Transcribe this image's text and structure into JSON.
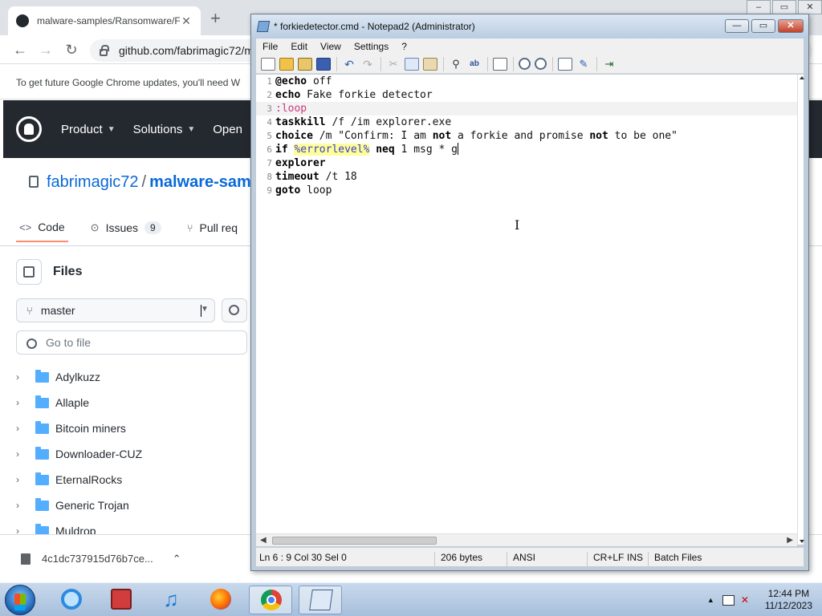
{
  "chrome": {
    "tab_title": "malware-samples/Ransomware/F",
    "new_tab": "+",
    "url": "github.com/fabrimagic72/m",
    "infobar": "To get future Google Chrome updates, you'll need W",
    "github_nav": [
      "Product",
      "Solutions",
      "Open"
    ],
    "repo_owner": "fabrimagic72",
    "repo_sep": "/",
    "repo_name": "malware-sam",
    "tabs": [
      {
        "label": "Code"
      },
      {
        "label": "Issues",
        "count": "9"
      },
      {
        "label": "Pull req"
      }
    ],
    "files_title": "Files",
    "branch": "master",
    "goto_placeholder": "Go to file",
    "tree": [
      "Adylkuzz",
      "Allaple",
      "Bitcoin miners",
      "Downloader-CUZ",
      "EternalRocks",
      "Generic Trojan",
      "Muldrop"
    ],
    "download_name": "4c1dc737915d76b7ce..."
  },
  "notepad": {
    "title": "* forkiedetector.cmd - Notepad2 (Administrator)",
    "menu": [
      "File",
      "Edit",
      "View",
      "Settings",
      "?"
    ],
    "lines": [
      {
        "n": "1",
        "parts": [
          {
            "t": "@echo",
            "c": "kw"
          },
          {
            "t": " off",
            "c": ""
          }
        ]
      },
      {
        "n": "2",
        "parts": [
          {
            "t": "echo",
            "c": "kw"
          },
          {
            "t": " Fake forkie detector",
            "c": ""
          }
        ]
      },
      {
        "n": "3",
        "parts": [
          {
            "t": ":loop",
            "c": "lbl"
          }
        ]
      },
      {
        "n": "4",
        "parts": [
          {
            "t": "taskkill",
            "c": "kw"
          },
          {
            "t": " /f /im explorer.exe",
            "c": ""
          }
        ]
      },
      {
        "n": "5",
        "parts": [
          {
            "t": "choice",
            "c": "kw"
          },
          {
            "t": " /m \"Confirm: I am ",
            "c": ""
          },
          {
            "t": "not",
            "c": "kw"
          },
          {
            "t": " a forkie and promise ",
            "c": ""
          },
          {
            "t": "not",
            "c": "kw"
          },
          {
            "t": " to be one\"",
            "c": ""
          }
        ]
      },
      {
        "n": "6",
        "parts": [
          {
            "t": "if",
            "c": "kw"
          },
          {
            "t": " ",
            "c": ""
          },
          {
            "t": "%errorlevel%",
            "c": "var"
          },
          {
            "t": " ",
            "c": ""
          },
          {
            "t": "neq",
            "c": "kw"
          },
          {
            "t": " 1 msg * g",
            "c": ""
          }
        ]
      },
      {
        "n": "7",
        "parts": [
          {
            "t": "explorer",
            "c": "kw"
          }
        ]
      },
      {
        "n": "8",
        "parts": [
          {
            "t": "timeout",
            "c": "kw"
          },
          {
            "t": " /t 18",
            "c": ""
          }
        ]
      },
      {
        "n": "9",
        "parts": [
          {
            "t": "goto",
            "c": "kw"
          },
          {
            "t": " loop",
            "c": ""
          }
        ]
      }
    ],
    "status": {
      "pos": "Ln 6 : 9   Col 30   Sel 0",
      "size": "206 bytes",
      "encoding": "ANSI",
      "eol": "CR+LF",
      "mode": "INS",
      "scheme": "Batch Files"
    }
  },
  "taskbar": {
    "time": "12:44 PM",
    "date": "11/12/2023"
  }
}
